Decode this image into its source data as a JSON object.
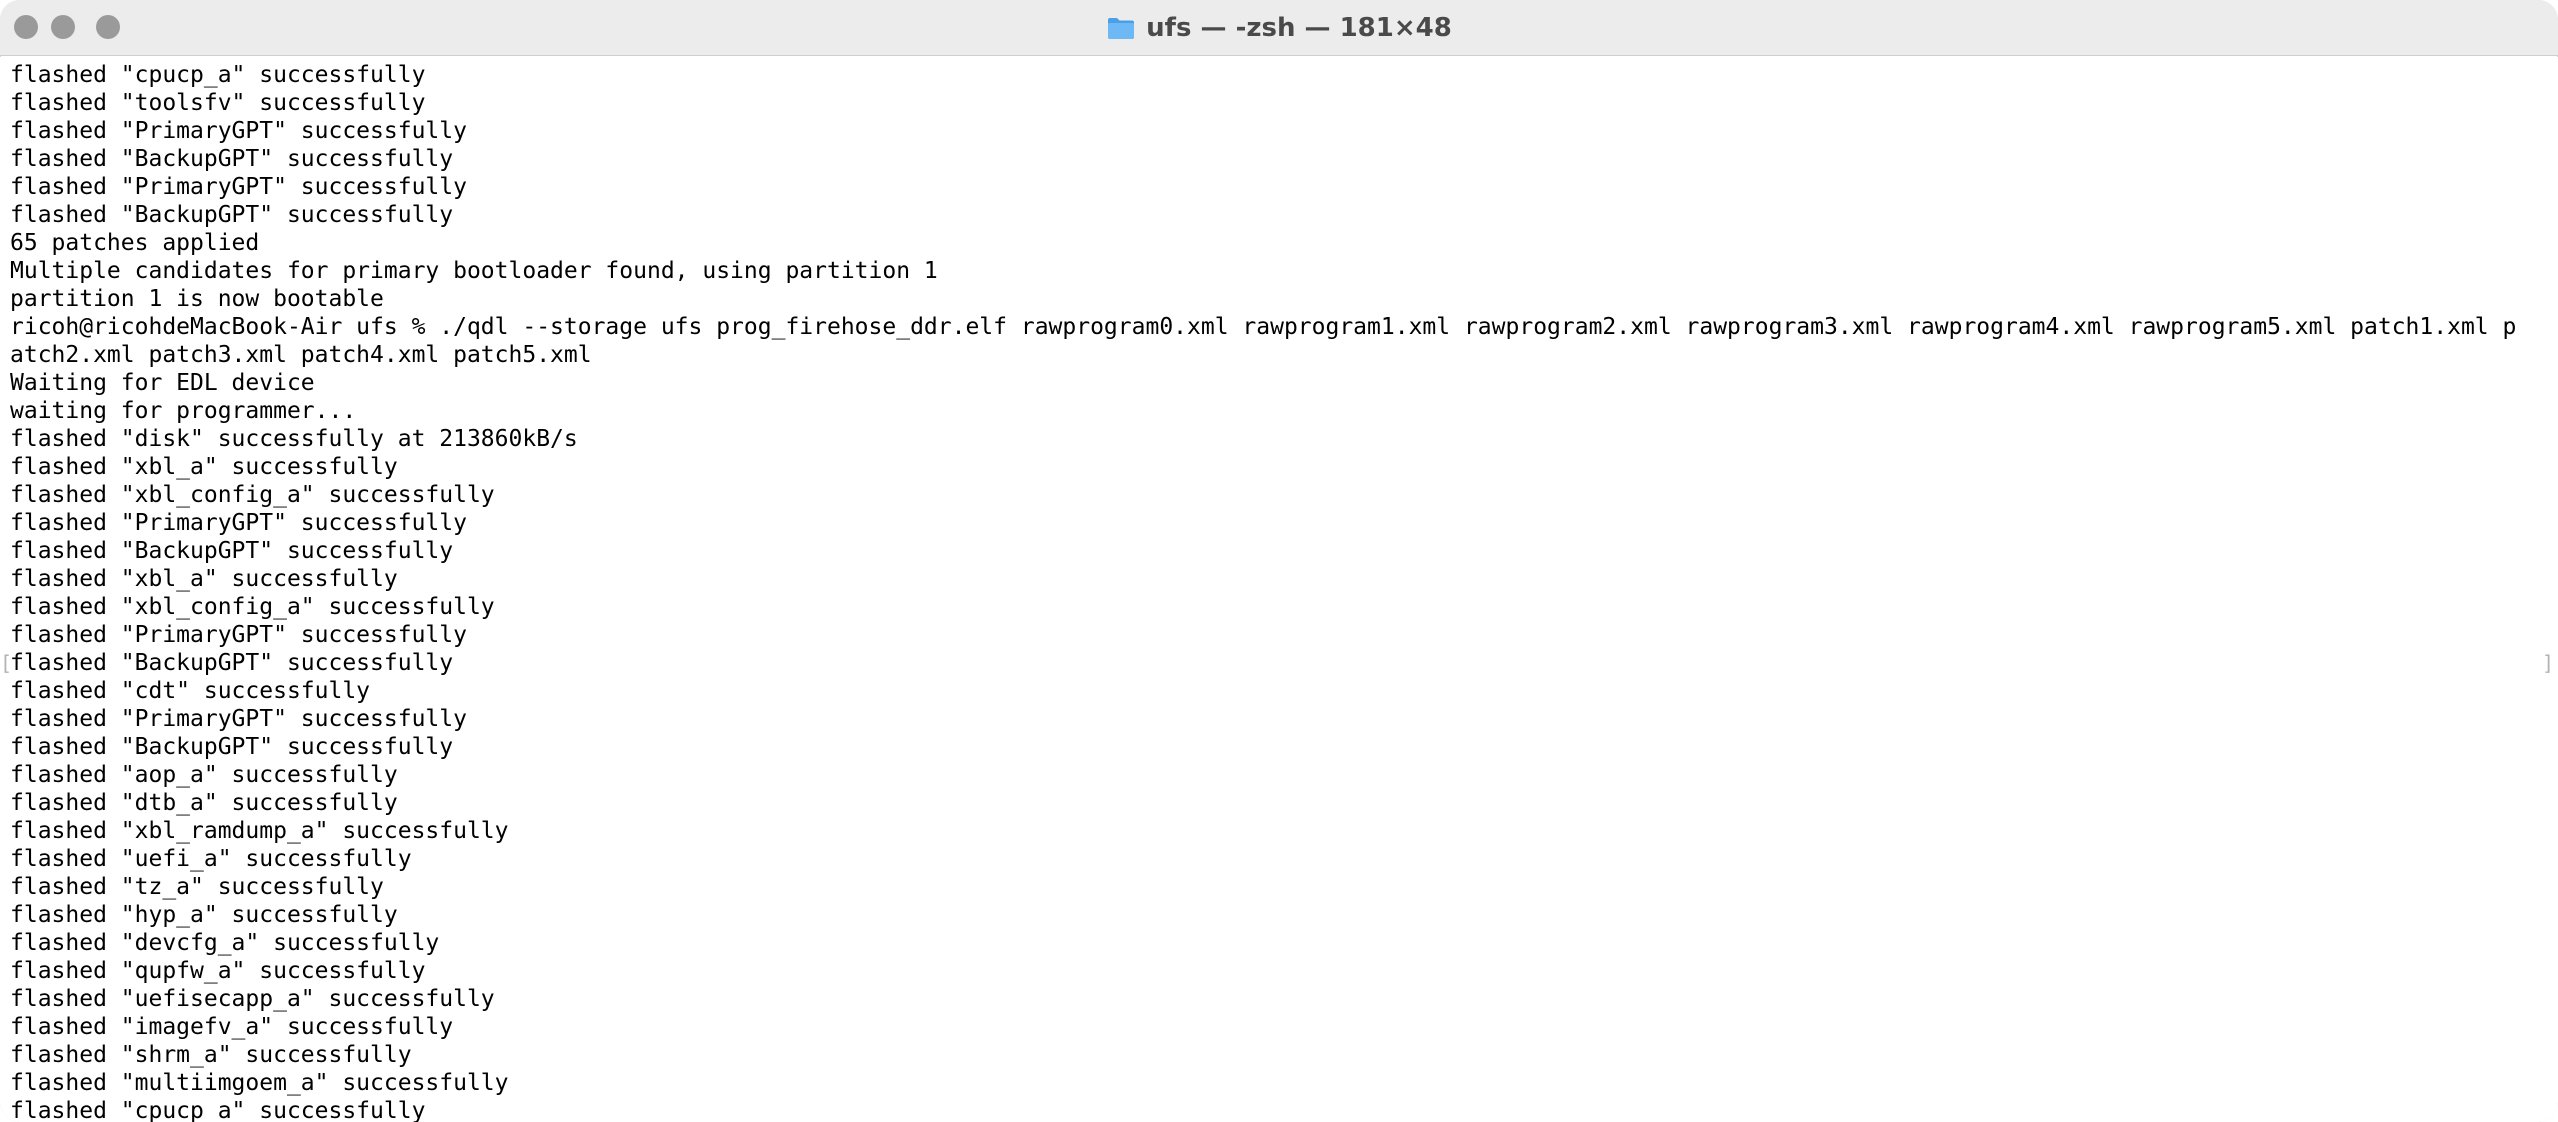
{
  "window": {
    "title": "ufs — -zsh — 181×48",
    "icon": "folder-icon",
    "accent_folder_color": "#5aaef0"
  },
  "terminal": {
    "lines": [
      "flashed \"cpucp_a\" successfully",
      "flashed \"toolsfv\" successfully",
      "flashed \"PrimaryGPT\" successfully",
      "flashed \"BackupGPT\" successfully",
      "flashed \"PrimaryGPT\" successfully",
      "flashed \"BackupGPT\" successfully",
      "65 patches applied",
      "Multiple candidates for primary bootloader found, using partition 1",
      "partition 1 is now bootable",
      "ricoh@ricohdeMacBook-Air ufs % ./qdl --storage ufs prog_firehose_ddr.elf rawprogram0.xml rawprogram1.xml rawprogram2.xml rawprogram3.xml rawprogram4.xml rawprogram5.xml patch1.xml p",
      "atch2.xml patch3.xml patch4.xml patch5.xml",
      "Waiting for EDL device",
      "waiting for programmer...",
      "flashed \"disk\" successfully at 213860kB/s",
      "flashed \"xbl_a\" successfully",
      "flashed \"xbl_config_a\" successfully",
      "flashed \"PrimaryGPT\" successfully",
      "flashed \"BackupGPT\" successfully",
      "flashed \"xbl_a\" successfully",
      "flashed \"xbl_config_a\" successfully",
      "flashed \"PrimaryGPT\" successfully",
      "flashed \"BackupGPT\" successfully",
      "flashed \"cdt\" successfully",
      "flashed \"PrimaryGPT\" successfully",
      "flashed \"BackupGPT\" successfully",
      "flashed \"aop_a\" successfully",
      "flashed \"dtb_a\" successfully",
      "flashed \"xbl_ramdump_a\" successfully",
      "flashed \"uefi_a\" successfully",
      "flashed \"tz_a\" successfully",
      "flashed \"hyp_a\" successfully",
      "flashed \"devcfg_a\" successfully",
      "flashed \"qupfw_a\" successfully",
      "flashed \"uefisecapp_a\" successfully",
      "flashed \"imagefv_a\" successfully",
      "flashed \"shrm_a\" successfully",
      "flashed \"multiimgoem_a\" successfully",
      "flashed \"cpucp_a\" successfully"
    ]
  }
}
